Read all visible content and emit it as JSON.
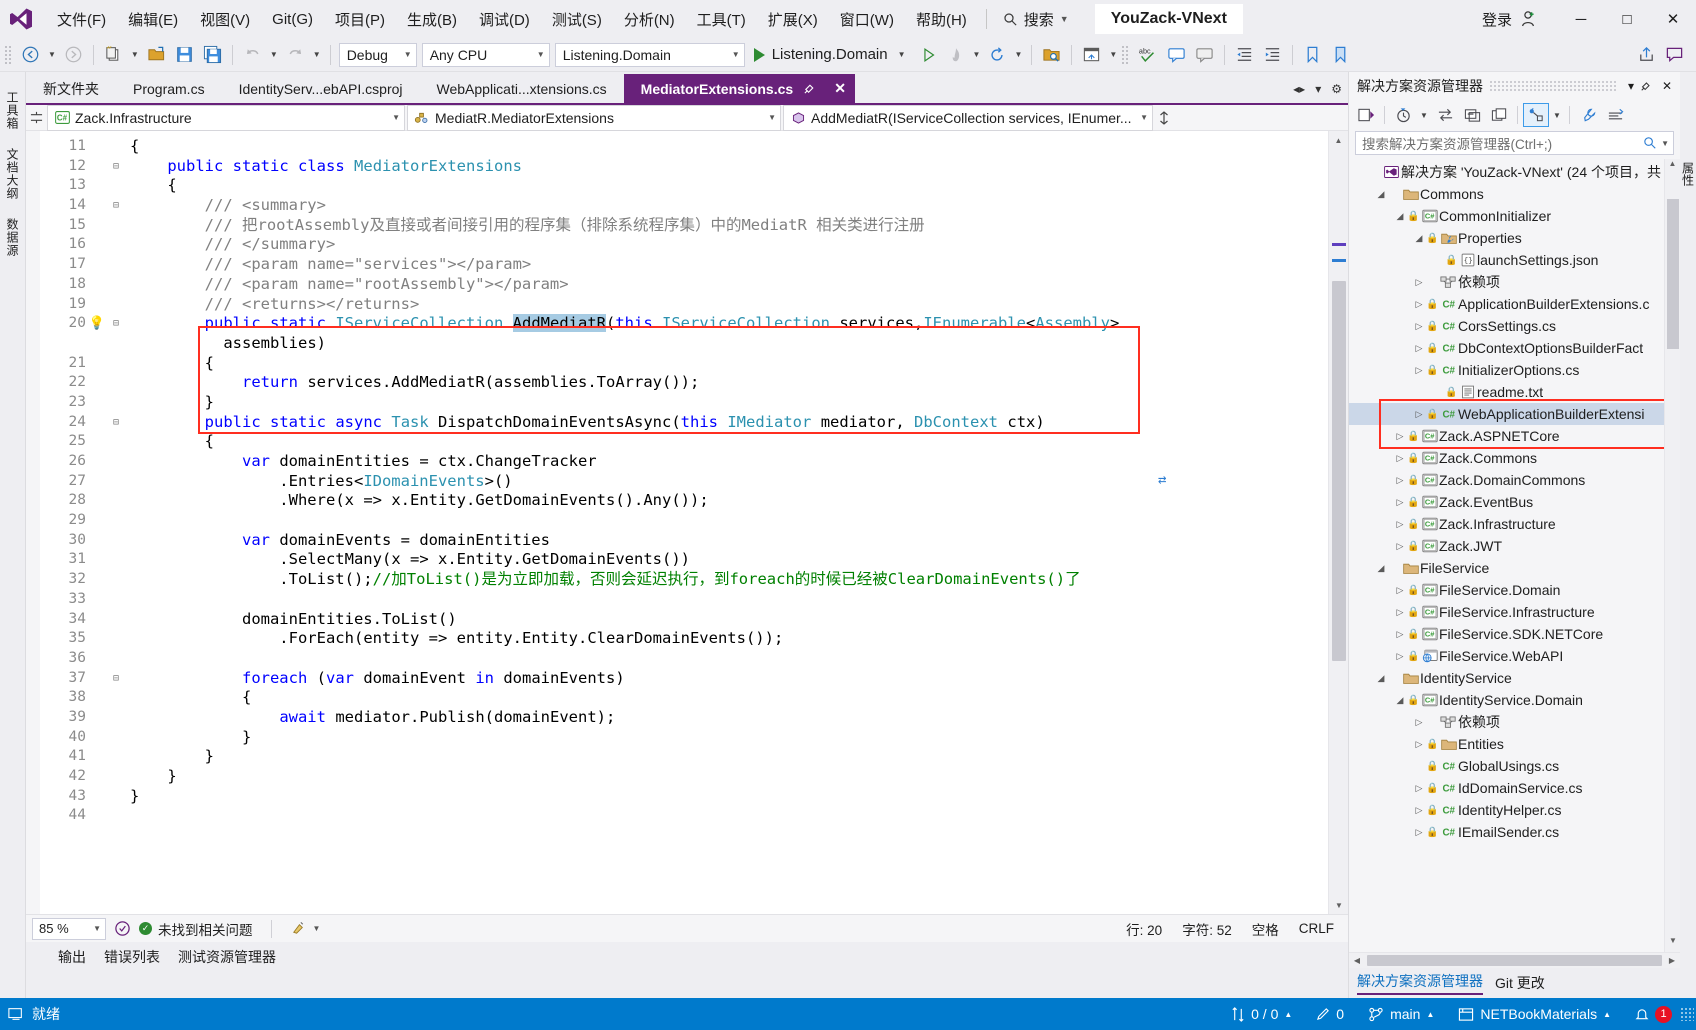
{
  "titlebar": {
    "logo_icon": "visual-studio-logo",
    "menus": [
      {
        "label": "文件(F)",
        "accel": "F"
      },
      {
        "label": "编辑(E)",
        "accel": "E"
      },
      {
        "label": "视图(V)",
        "accel": "V"
      },
      {
        "label": "Git(G)",
        "accel": "G"
      },
      {
        "label": "项目(P)",
        "accel": "P"
      },
      {
        "label": "生成(B)",
        "accel": "B"
      },
      {
        "label": "调试(D)",
        "accel": "D"
      },
      {
        "label": "测试(S)",
        "accel": "S"
      },
      {
        "label": "分析(N)",
        "accel": "N"
      },
      {
        "label": "工具(T)",
        "accel": "T"
      },
      {
        "label": "扩展(X)",
        "accel": "X"
      },
      {
        "label": "窗口(W)",
        "accel": "W"
      },
      {
        "label": "帮助(H)",
        "accel": "H"
      }
    ],
    "search_placeholder": "搜索",
    "app_title": "YouZack-VNext",
    "login_label": "登录",
    "minimize": "─",
    "maximize": "□",
    "close": "✕"
  },
  "toolbar": {
    "config": "Debug",
    "platform": "Any CPU",
    "startup_project": "Listening.Domain",
    "run_label": "Listening.Domain",
    "icons": [
      "back-arrow-icon",
      "forward-arrow-icon",
      "new-project-icon",
      "open-file-icon",
      "save-icon",
      "save-all-icon",
      "undo-icon",
      "redo-icon",
      "run-icon",
      "start-without-debug-icon",
      "hot-reload-icon",
      "restart-icon",
      "folder-search-icon",
      "window-layout-icon",
      "comment-icon",
      "spellcheck-icon",
      "undo-indent-icon",
      "outdent-icon",
      "indent-icon",
      "bookmark-icon",
      "toggle-bookmark-icon",
      "share-icon",
      "feedback-icon"
    ]
  },
  "doc_tabs": [
    {
      "label": "新文件夹",
      "active": false
    },
    {
      "label": "Program.cs",
      "active": false
    },
    {
      "label": "IdentityServ...ebAPI.csproj",
      "active": false
    },
    {
      "label": "WebApplicati...xtensions.cs",
      "active": false
    },
    {
      "label": "MediatorExtensions.cs",
      "active": true
    }
  ],
  "navbar": {
    "project": "Zack.Infrastructure",
    "project_icon": "csharp-project-icon",
    "type": "MediatR.MediatorExtensions",
    "type_icon": "class-icon",
    "member": "AddMediatR(IServiceCollection services, IEnumer...",
    "member_icon": "method-icon"
  },
  "code": {
    "lines": [
      {
        "n": "11",
        "indent": 0,
        "fold": "",
        "text": "{",
        "glyph": ""
      },
      {
        "n": "12",
        "indent": 0,
        "fold": "-",
        "text": "    public static class MediatorExtensions",
        "glyph": ""
      },
      {
        "n": "13",
        "indent": 0,
        "fold": "",
        "text": "    {",
        "glyph": ""
      },
      {
        "n": "14",
        "indent": 0,
        "fold": "-",
        "text": "        /// <summary>",
        "glyph": ""
      },
      {
        "n": "15",
        "indent": 0,
        "fold": "",
        "text": "        /// 把rootAssembly及直接或者间接引用的程序集（排除系统程序集）中的MediatR 相关类进行注册",
        "glyph": ""
      },
      {
        "n": "16",
        "indent": 0,
        "fold": "",
        "text": "        /// </summary>",
        "glyph": ""
      },
      {
        "n": "17",
        "indent": 0,
        "fold": "",
        "text": "        /// <param name=\"services\"></param>",
        "glyph": ""
      },
      {
        "n": "18",
        "indent": 0,
        "fold": "",
        "text": "        /// <param name=\"rootAssembly\"></param>",
        "glyph": ""
      },
      {
        "n": "19",
        "indent": 0,
        "fold": "",
        "text": "        /// <returns></returns>",
        "glyph": ""
      },
      {
        "n": "20",
        "indent": 0,
        "fold": "-",
        "text": "        public static IServiceCollection AddMediatR(this IServiceCollection services,IEnumerable<Assembly>",
        "glyph": "bulb"
      },
      {
        "n": "",
        "indent": 0,
        "fold": "",
        "text": "          assemblies)",
        "glyph": ""
      },
      {
        "n": "21",
        "indent": 0,
        "fold": "",
        "text": "        {",
        "glyph": ""
      },
      {
        "n": "22",
        "indent": 0,
        "fold": "",
        "text": "            return services.AddMediatR(assemblies.ToArray());",
        "glyph": ""
      },
      {
        "n": "23",
        "indent": 0,
        "fold": "",
        "text": "        }",
        "glyph": ""
      },
      {
        "n": "24",
        "indent": 0,
        "fold": "-",
        "text": "        public static async Task DispatchDomainEventsAsync(this IMediator mediator, DbContext ctx)",
        "glyph": ""
      },
      {
        "n": "25",
        "indent": 0,
        "fold": "",
        "text": "        {",
        "glyph": ""
      },
      {
        "n": "26",
        "indent": 0,
        "fold": "",
        "text": "            var domainEntities = ctx.ChangeTracker",
        "glyph": ""
      },
      {
        "n": "27",
        "indent": 0,
        "fold": "",
        "text": "                .Entries<IDomainEvents>()",
        "glyph": ""
      },
      {
        "n": "28",
        "indent": 0,
        "fold": "",
        "text": "                .Where(x => x.Entity.GetDomainEvents().Any());",
        "glyph": ""
      },
      {
        "n": "29",
        "indent": 0,
        "fold": "",
        "text": "",
        "glyph": ""
      },
      {
        "n": "30",
        "indent": 0,
        "fold": "",
        "text": "            var domainEvents = domainEntities",
        "glyph": ""
      },
      {
        "n": "31",
        "indent": 0,
        "fold": "",
        "text": "                .SelectMany(x => x.Entity.GetDomainEvents())",
        "glyph": ""
      },
      {
        "n": "32",
        "indent": 0,
        "fold": "",
        "text": "                .ToList();//加ToList()是为立即加载，否则会延迟执行，到foreach的时候已经被ClearDomainEvents()了",
        "glyph": ""
      },
      {
        "n": "33",
        "indent": 0,
        "fold": "",
        "text": "",
        "glyph": ""
      },
      {
        "n": "34",
        "indent": 0,
        "fold": "",
        "text": "            domainEntities.ToList()",
        "glyph": ""
      },
      {
        "n": "35",
        "indent": 0,
        "fold": "",
        "text": "                .ForEach(entity => entity.Entity.ClearDomainEvents());",
        "glyph": ""
      },
      {
        "n": "36",
        "indent": 0,
        "fold": "",
        "text": "",
        "glyph": ""
      },
      {
        "n": "37",
        "indent": 0,
        "fold": "-",
        "text": "            foreach (var domainEvent in domainEvents)",
        "glyph": ""
      },
      {
        "n": "38",
        "indent": 0,
        "fold": "",
        "text": "            {",
        "glyph": ""
      },
      {
        "n": "39",
        "indent": 0,
        "fold": "",
        "text": "                await mediator.Publish(domainEvent);",
        "glyph": ""
      },
      {
        "n": "40",
        "indent": 0,
        "fold": "",
        "text": "            }",
        "glyph": ""
      },
      {
        "n": "41",
        "indent": 0,
        "fold": "",
        "text": "        }",
        "glyph": ""
      },
      {
        "n": "42",
        "indent": 0,
        "fold": "",
        "text": "    }",
        "glyph": ""
      },
      {
        "n": "43",
        "indent": 0,
        "fold": "",
        "text": "}",
        "glyph": ""
      },
      {
        "n": "44",
        "indent": 0,
        "fold": "",
        "text": "",
        "glyph": ""
      }
    ],
    "highlighted_token": "AddMediatR"
  },
  "editor_status": {
    "zoom": "85 %",
    "problems": "未找到相关问题",
    "line": "行: 20",
    "column": "字符: 52",
    "spaces": "空格",
    "eol": "CRLF"
  },
  "bottom_tabs": [
    {
      "label": "输出"
    },
    {
      "label": "错误列表"
    },
    {
      "label": "测试资源管理器"
    }
  ],
  "left_strip": [
    {
      "label": "工具箱"
    },
    {
      "label": "文档大纲"
    },
    {
      "label": "数据源"
    }
  ],
  "right_strip": [
    {
      "label": "属性"
    }
  ],
  "solution_explorer": {
    "title": "解决方案资源管理器",
    "search_placeholder": "搜索解决方案资源管理器(Ctrl+;)",
    "header_buttons": [
      "float-icon",
      "close-icon",
      "dropdown-icon",
      "gear-icon"
    ],
    "toolbar_icons": [
      "home-view-icon",
      "pending-changes-icon",
      "sync-icon",
      "collapse-all-icon",
      "show-all-files-icon",
      "view-code-icon",
      "properties-icon",
      "refresh-icon",
      "search-icon"
    ],
    "tree": [
      {
        "depth": 0,
        "arrow": "none",
        "lock": false,
        "icon": "solution-icon",
        "label": "解决方案 'YouZack-VNext' (24 个项目，共 ",
        "sel": false,
        "boxed": false
      },
      {
        "depth": 1,
        "arrow": "down",
        "lock": false,
        "icon": "folder-icon",
        "label": "Commons",
        "sel": false,
        "boxed": false
      },
      {
        "depth": 2,
        "arrow": "down",
        "lock": true,
        "icon": "csharp-project-icon",
        "label": "CommonInitializer",
        "sel": false,
        "boxed": false
      },
      {
        "depth": 3,
        "arrow": "down",
        "lock": true,
        "icon": "properties-folder-icon",
        "label": "Properties",
        "sel": false,
        "boxed": false
      },
      {
        "depth": 4,
        "arrow": "none",
        "lock": true,
        "icon": "json-file-icon",
        "label": "launchSettings.json",
        "sel": false,
        "boxed": false
      },
      {
        "depth": 3,
        "arrow": "right",
        "lock": false,
        "icon": "dependencies-icon",
        "label": "依赖项",
        "sel": false,
        "boxed": false
      },
      {
        "depth": 3,
        "arrow": "right",
        "lock": true,
        "icon": "cs-file-icon",
        "label": "ApplicationBuilderExtensions.c",
        "sel": false,
        "boxed": false
      },
      {
        "depth": 3,
        "arrow": "right",
        "lock": true,
        "icon": "cs-file-icon",
        "label": "CorsSettings.cs",
        "sel": false,
        "boxed": false
      },
      {
        "depth": 3,
        "arrow": "right",
        "lock": true,
        "icon": "cs-file-icon",
        "label": "DbContextOptionsBuilderFact",
        "sel": false,
        "boxed": false
      },
      {
        "depth": 3,
        "arrow": "right",
        "lock": true,
        "icon": "cs-file-icon",
        "label": "InitializerOptions.cs",
        "sel": false,
        "boxed": false
      },
      {
        "depth": 4,
        "arrow": "none",
        "lock": true,
        "icon": "text-file-icon",
        "label": "readme.txt",
        "sel": false,
        "boxed": true
      },
      {
        "depth": 3,
        "arrow": "right",
        "lock": true,
        "icon": "cs-file-icon",
        "label": "WebApplicationBuilderExtensi",
        "sel": true,
        "boxed": true
      },
      {
        "depth": 2,
        "arrow": "right",
        "lock": true,
        "icon": "csharp-project-icon",
        "label": "Zack.ASPNETCore",
        "sel": false,
        "boxed": false
      },
      {
        "depth": 2,
        "arrow": "right",
        "lock": true,
        "icon": "csharp-project-icon",
        "label": "Zack.Commons",
        "sel": false,
        "boxed": false
      },
      {
        "depth": 2,
        "arrow": "right",
        "lock": true,
        "icon": "csharp-project-icon",
        "label": "Zack.DomainCommons",
        "sel": false,
        "boxed": false
      },
      {
        "depth": 2,
        "arrow": "right",
        "lock": true,
        "icon": "csharp-project-icon",
        "label": "Zack.EventBus",
        "sel": false,
        "boxed": false
      },
      {
        "depth": 2,
        "arrow": "right",
        "lock": true,
        "icon": "csharp-project-icon",
        "label": "Zack.Infrastructure",
        "sel": false,
        "boxed": false
      },
      {
        "depth": 2,
        "arrow": "right",
        "lock": true,
        "icon": "csharp-project-icon",
        "label": "Zack.JWT",
        "sel": false,
        "boxed": false
      },
      {
        "depth": 1,
        "arrow": "down",
        "lock": false,
        "icon": "folder-icon",
        "label": "FileService",
        "sel": false,
        "boxed": false
      },
      {
        "depth": 2,
        "arrow": "right",
        "lock": true,
        "icon": "csharp-project-icon",
        "label": "FileService.Domain",
        "sel": false,
        "boxed": false
      },
      {
        "depth": 2,
        "arrow": "right",
        "lock": true,
        "icon": "csharp-project-icon",
        "label": "FileService.Infrastructure",
        "sel": false,
        "boxed": false
      },
      {
        "depth": 2,
        "arrow": "right",
        "lock": true,
        "icon": "csharp-project-icon",
        "label": "FileService.SDK.NETCore",
        "sel": false,
        "boxed": false
      },
      {
        "depth": 2,
        "arrow": "right",
        "lock": true,
        "icon": "web-project-icon",
        "label": "FileService.WebAPI",
        "sel": false,
        "boxed": false
      },
      {
        "depth": 1,
        "arrow": "down",
        "lock": false,
        "icon": "folder-icon",
        "label": "IdentityService",
        "sel": false,
        "boxed": false
      },
      {
        "depth": 2,
        "arrow": "down",
        "lock": true,
        "icon": "csharp-project-icon",
        "label": "IdentityService.Domain",
        "sel": false,
        "boxed": false
      },
      {
        "depth": 3,
        "arrow": "right",
        "lock": false,
        "icon": "dependencies-icon",
        "label": "依赖项",
        "sel": false,
        "boxed": false
      },
      {
        "depth": 3,
        "arrow": "right",
        "lock": true,
        "icon": "folder-icon",
        "label": "Entities",
        "sel": false,
        "boxed": false
      },
      {
        "depth": 3,
        "arrow": "none",
        "lock": true,
        "icon": "cs-file-icon",
        "label": "GlobalUsings.cs",
        "sel": false,
        "boxed": false
      },
      {
        "depth": 3,
        "arrow": "right",
        "lock": true,
        "icon": "cs-file-icon",
        "label": "IdDomainService.cs",
        "sel": false,
        "boxed": false
      },
      {
        "depth": 3,
        "arrow": "right",
        "lock": true,
        "icon": "cs-file-icon",
        "label": "IdentityHelper.cs",
        "sel": false,
        "boxed": false
      },
      {
        "depth": 3,
        "arrow": "right",
        "lock": true,
        "icon": "cs-file-icon",
        "label": "IEmailSender.cs",
        "sel": false,
        "boxed": false
      }
    ],
    "footer_tabs": [
      {
        "label": "解决方案资源管理器",
        "active": true
      },
      {
        "label": "Git 更改",
        "active": false
      }
    ]
  },
  "statusbar": {
    "ready": "就绪",
    "sync": "0 / 0",
    "edits": "0",
    "branch": "main",
    "repo": "NETBookMaterials",
    "notifications": "1"
  }
}
